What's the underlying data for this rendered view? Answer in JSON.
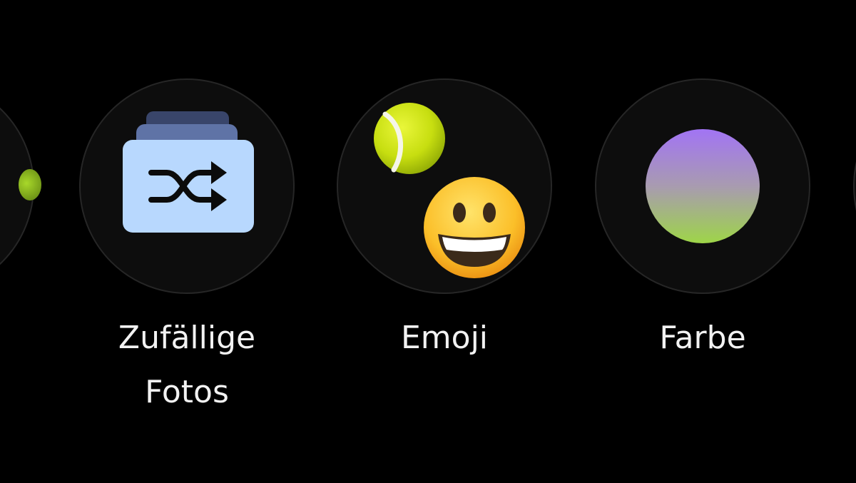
{
  "options": [
    {
      "id": "partial-left",
      "label": ""
    },
    {
      "id": "random-photos",
      "label": "Zufällige\nFotos",
      "icon": "shuffle-icon"
    },
    {
      "id": "emoji",
      "label": "Emoji",
      "icons": [
        "tennis-ball-icon",
        "grinning-face-icon"
      ]
    },
    {
      "id": "color",
      "label": "Farbe",
      "gradient_colors": [
        "#a274f4",
        "#9ed548"
      ]
    },
    {
      "id": "partial-right",
      "label": ""
    }
  ],
  "colors": {
    "background": "#000000",
    "circle_fill": "#0d0d0d",
    "circle_border": "#262626",
    "label_text": "#f2f2f2",
    "folder": "#b8d8fe"
  }
}
